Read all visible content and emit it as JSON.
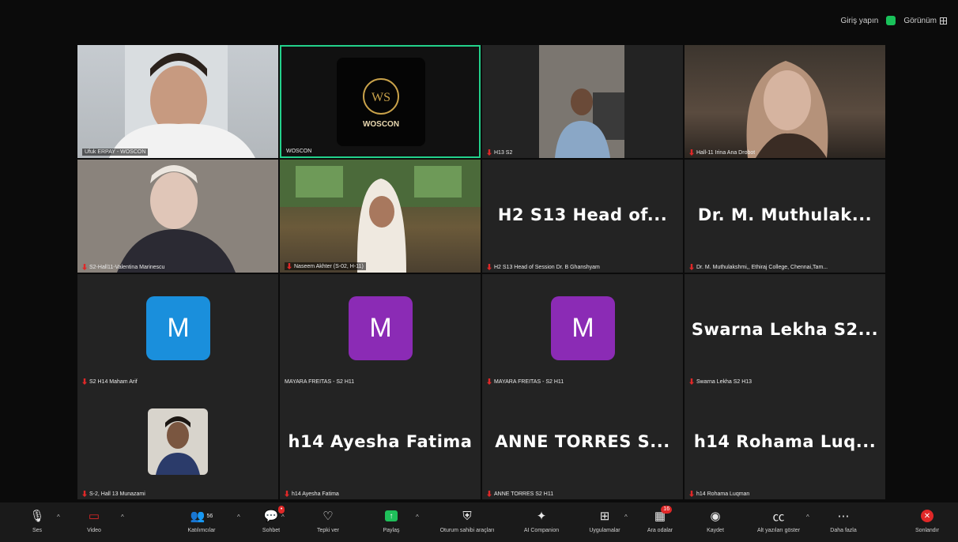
{
  "top": {
    "sign_in": "Giriş yapın",
    "view": "Görünüm"
  },
  "tiles": [
    {
      "type": "video",
      "name": "Ufuk ERPAY - WOSCON",
      "muted": false,
      "boxed": true
    },
    {
      "type": "logo",
      "name": "WOSCON",
      "logo_text": "WOSCON",
      "active": true
    },
    {
      "type": "video",
      "name": "H13 S2",
      "muted": true
    },
    {
      "type": "video",
      "name": "Hall-11 Irina Ana Drobot",
      "muted": true
    },
    {
      "type": "video",
      "name": "S2-Hall11-Valentina Marinescu",
      "muted": true
    },
    {
      "type": "video",
      "name": "Naseem Akhter (S-02, H-11)",
      "muted": true,
      "boxed": true
    },
    {
      "type": "text",
      "big": "H2 S13 Head of...",
      "name": "H2 S13 Head of Session Dr. B Ghanshyam",
      "muted": true
    },
    {
      "type": "text",
      "big": "Dr. M. Muthulak...",
      "name": "Dr. M. Muthulakshmi,, Ethiraj College, Chennai,Tam...",
      "muted": true
    },
    {
      "type": "avatar",
      "letter": "M",
      "color": "blue",
      "name": "S2 H14 Maham Arif",
      "muted": true
    },
    {
      "type": "avatar",
      "letter": "M",
      "color": "purple",
      "name": "MAYARA FREITAS - S2 H11",
      "muted": false
    },
    {
      "type": "avatar",
      "letter": "M",
      "color": "purple",
      "name": "MAYARA FREITAS - S2 H11",
      "muted": true
    },
    {
      "type": "text",
      "big": "Swarna Lekha S2...",
      "name": "Swarna Lekha S2 H13",
      "muted": true
    },
    {
      "type": "photo",
      "name": "S-2, Hall 13 Munazami",
      "muted": true
    },
    {
      "type": "text",
      "big": "h14 Ayesha Fatima",
      "name": "h14 Ayesha Fatima",
      "muted": true
    },
    {
      "type": "text",
      "big": "ANNE TORRES S...",
      "name": "ANNE TORRES S2 H11",
      "muted": true
    },
    {
      "type": "text",
      "big": "h14 Rohama Luq...",
      "name": "h14 Rohama Luqman",
      "muted": true
    }
  ],
  "toolbar": {
    "audio": "Ses",
    "video": "Video",
    "participants": "Katılımcılar",
    "participants_count": "56",
    "chat": "Sohbet",
    "react": "Tepki ver",
    "share": "Paylaş",
    "host_tools": "Oturum sahibi araçları",
    "ai": "AI Companion",
    "apps": "Uygulamalar",
    "breakout": "Ara odalar",
    "breakout_badge": "16",
    "record": "Kaydet",
    "captions": "Alt yazıları göster",
    "more": "Daha fazla",
    "end": "Sonlandır"
  }
}
